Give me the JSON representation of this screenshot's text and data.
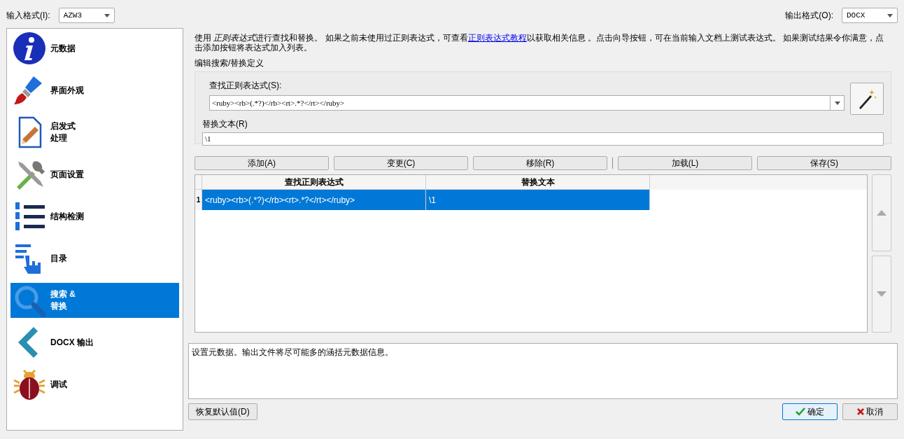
{
  "top_bar": {
    "input_format": {
      "label": "输入格式(I):",
      "value": "AZW3"
    },
    "output_format": {
      "label": "输出格式(O):",
      "value": "DOCX"
    }
  },
  "sidebar": {
    "items": [
      {
        "lines": [
          "元数据"
        ],
        "kind": "info",
        "selected": false
      },
      {
        "lines": [
          "界面外观"
        ],
        "kind": "brush",
        "selected": false
      },
      {
        "lines": [
          "启发式",
          "处理"
        ],
        "kind": "document",
        "selected": false
      },
      {
        "lines": [
          "页面设置"
        ],
        "kind": "tools",
        "selected": false
      },
      {
        "lines": [
          "结构检测"
        ],
        "kind": "list",
        "selected": false
      },
      {
        "lines": [
          "目录"
        ],
        "kind": "toc",
        "selected": false
      },
      {
        "lines": [
          "搜索 &",
          "替换"
        ],
        "kind": "search",
        "selected": true
      },
      {
        "lines": [
          "DOCX 输出"
        ],
        "kind": "chevron",
        "selected": false
      },
      {
        "lines": [
          "调试"
        ],
        "kind": "bug",
        "selected": false
      }
    ]
  },
  "intro": {
    "start": "使用 ",
    "emphasis": "正则表达式",
    "before": "进行查找和替换。 如果之前未使用过正则表达式，可查看",
    "link": "正则表达式教程",
    "after": "以获取相关信息 。点击向导按钮，可在当前输入文档上测试表达式。 如果测试结果令你满意，点击添加按钮将表达式加入列表。"
  },
  "definition": {
    "title": "编辑搜索/替换定义",
    "search_label": "查找正则表达式(S):",
    "search_value": "<ruby><rb>(.*?)</rb><rt>.*?</rt></ruby>",
    "replace_label": "替换文本(R)",
    "replace_value": "\\1"
  },
  "actions": [
    "添加(A)",
    "变更(C)",
    "移除(R)",
    "加载(L)",
    "保存(S)"
  ],
  "table": {
    "columns": [
      "查找正则表达式",
      "替换文本"
    ],
    "rows": [
      {
        "number": "1",
        "cells": [
          "<ruby><rb>(.*?)</rb><rt>.*?</rt></ruby>",
          "\\1"
        ],
        "selected": true
      }
    ]
  },
  "help_text": "设置元数据。输出文件将尽可能多的涵括元数据信息。",
  "buttons": {
    "restore": "恢复默认值(D)",
    "ok": "确定",
    "cancel": "取消"
  }
}
